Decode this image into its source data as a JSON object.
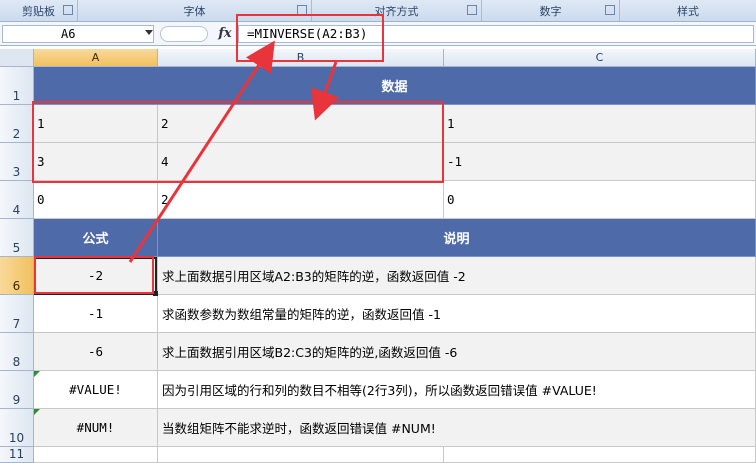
{
  "ribbon": {
    "groups": [
      {
        "label": "剪贴板"
      },
      {
        "label": "字体"
      },
      {
        "label": "对齐方式"
      },
      {
        "label": "数字"
      },
      {
        "label": "样式"
      }
    ]
  },
  "formula_bar": {
    "name_box": "A6",
    "fx_label": "fx",
    "formula": "=MINVERSE(A2:B3)"
  },
  "columns": [
    "A",
    "B",
    "C"
  ],
  "rows": [
    "1",
    "2",
    "3",
    "4",
    "5",
    "6",
    "7",
    "8",
    "9",
    "10",
    "11"
  ],
  "sheet": {
    "data_header": "数据",
    "data_rows": [
      [
        "1",
        "2",
        "1"
      ],
      [
        "3",
        "4",
        "-1"
      ],
      [
        "0",
        "2",
        "0"
      ]
    ],
    "formula_header": "公式",
    "desc_header": "说明",
    "results": [
      {
        "value": "-2",
        "desc": "求上面数据引用区域A2:B3的矩阵的逆，函数返回值 -2"
      },
      {
        "value": "-1",
        "desc": "求函数参数为数组常量的矩阵的逆，函数返回值 -1"
      },
      {
        "value": "-6",
        "desc": "求上面数据引用区域B2:C3的矩阵的逆,函数返回值 -6"
      },
      {
        "value": "#VALUE!",
        "desc": "因为引用区域的行和列的数目不相等(2行3列)，所以函数返回错误值 #VALUE!"
      },
      {
        "value": "#NUM!",
        "desc": "当数组矩阵不能求逆时，函数返回错误值 #NUM!"
      }
    ]
  },
  "colors": {
    "header_fill": "#4f6aa8",
    "highlight_red": "#e8343b",
    "cell_fill": "#f2f2f2"
  }
}
